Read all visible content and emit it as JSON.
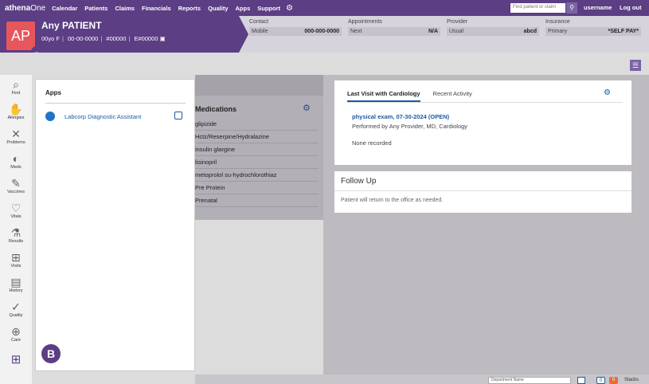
{
  "topnav": {
    "brand_main": "athena",
    "brand_sub": "One",
    "items": [
      "Calendar",
      "Patients",
      "Claims",
      "Financials",
      "Reports",
      "Quality",
      "Apps",
      "Support"
    ],
    "search_placeholder": "Find patient or claim",
    "username": "username",
    "logout": "Log out"
  },
  "patient": {
    "initials": "AP",
    "name": "Any  PATIENT",
    "age_sex": "00yo F",
    "dob": "00-00-0000",
    "id": "#00000",
    "enterprise_id": "E#00000"
  },
  "header": {
    "contact_label": "Contact",
    "contact_type": "Mobile",
    "contact_value": "000-000-0000",
    "appointments_label": "Appointments",
    "appt_type": "Next",
    "appt_value": "N/A",
    "provider_label": "Provider",
    "provider_type": "Usual",
    "provider_value": "abcd",
    "insurance_label": "Insurance",
    "insurance_type": "Primary",
    "insurance_value": "*SELF PAY*"
  },
  "sidebar": {
    "items": [
      "Find",
      "Allergies",
      "Problems",
      "Meds",
      "Vaccines",
      "Vitals",
      "Results",
      "Visits",
      "History",
      "Quality",
      "Care"
    ]
  },
  "apps_panel": {
    "title": "Apps",
    "items": [
      {
        "label": "Labcorp Diagnostic Assistant"
      }
    ],
    "badge": "B"
  },
  "medications": {
    "title": "Medications",
    "items": [
      "glipizide",
      "Hctz/Reserpine/Hydralazine",
      "insulin glargine",
      "lisinopril",
      "metoprolol su-hydrochlorothiaz",
      "Pre Protein",
      "Prenatal"
    ]
  },
  "visit_card": {
    "tabs": [
      "Last Visit with Cardiology",
      "Recent Activity"
    ],
    "visit_link": "physical exam, 07-30-2024 (OPEN)",
    "performed_by": "Performed by Any Provider, MD, Cardiology",
    "none_recorded": "None recorded"
  },
  "followup": {
    "title": "Follow Up",
    "text": "Patient will return to the office as needed."
  },
  "bottombar": {
    "dept_label": "Department Name",
    "count1": "0",
    "count2": "0",
    "stacks": "Stacks"
  },
  "colors": {
    "brand_purple": "#5b3e84",
    "avatar_red": "#e7555d",
    "link_blue": "#1a5aa6"
  }
}
